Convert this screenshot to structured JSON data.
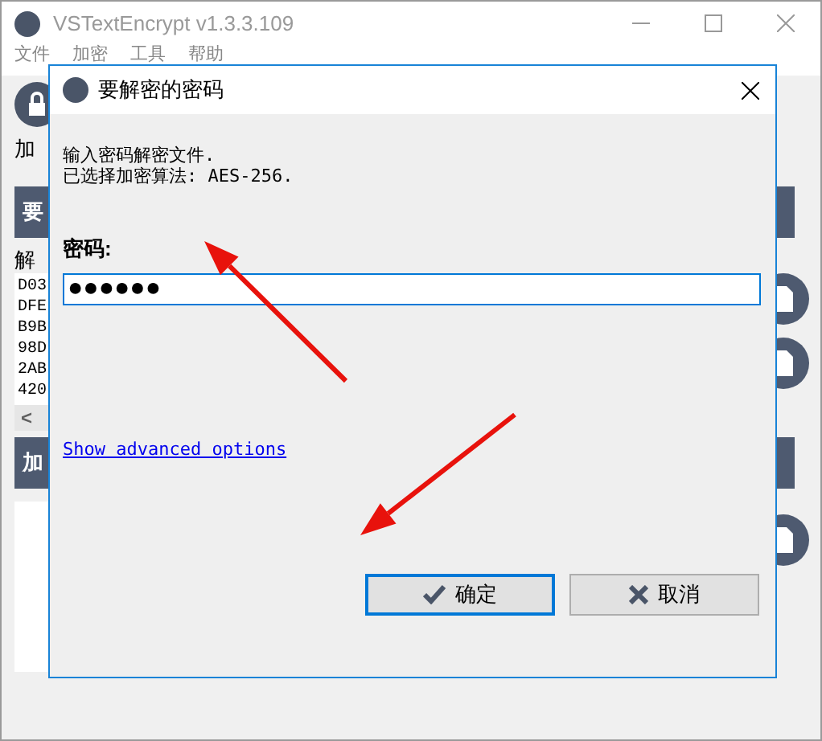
{
  "main_window": {
    "title": "VSTextEncrypt v1.3.3.109",
    "menu": [
      "文件",
      "加密",
      "工具",
      "帮助"
    ],
    "toolbar_label": "加",
    "section_1_header": "要",
    "parse_label": "解",
    "list_rows": [
      "D03",
      "DFE",
      "B9B",
      "98D",
      "2AB",
      "420"
    ],
    "scroll_left": "<",
    "section_2_header": "加"
  },
  "dialog": {
    "title": "要解密的密码",
    "message_lines": [
      "输入密码解密文件.",
      "已选择加密算法: AES-256."
    ],
    "password_label": "密码:",
    "password_value": "●●●●●●",
    "advanced_link": "Show advanced options",
    "buttons": [
      {
        "kind": "ok",
        "label": "确定",
        "selected": true
      },
      {
        "kind": "cancel",
        "label": "取消",
        "selected": false
      }
    ]
  },
  "annotations": [
    {
      "kind": "arrow"
    },
    {
      "kind": "arrow"
    }
  ]
}
